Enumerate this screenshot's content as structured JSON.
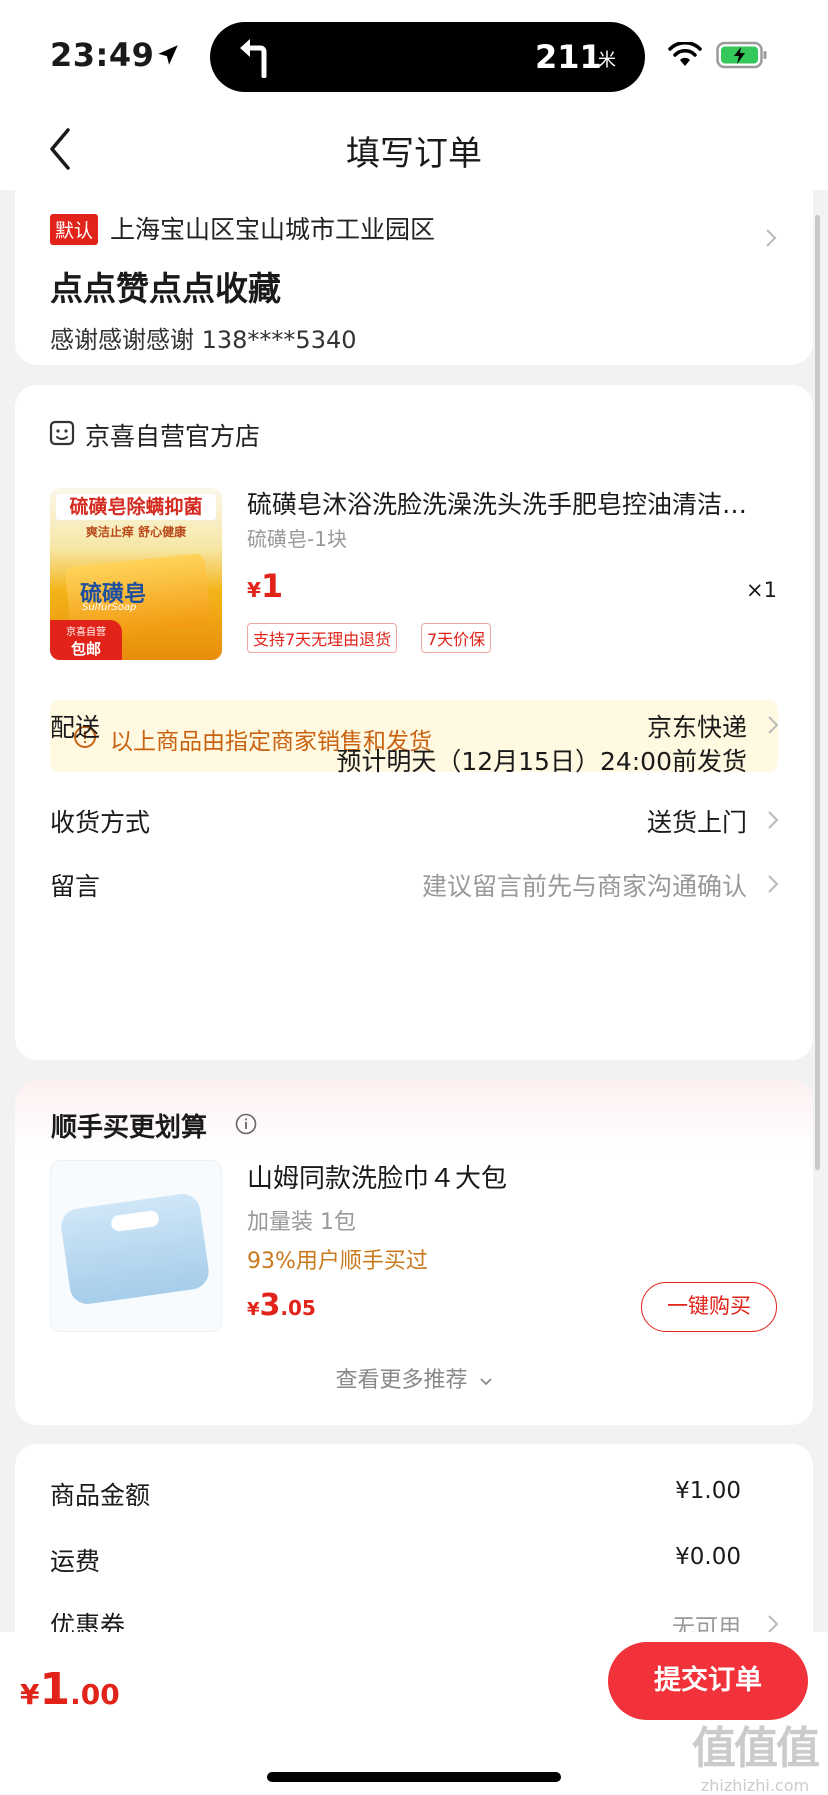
{
  "status_bar": {
    "time": "23:49",
    "nav_distance": "211",
    "nav_unit": "米"
  },
  "header": {
    "title": "填写订单"
  },
  "address": {
    "default_tag": "默认",
    "region": "上海宝山区宝山城市工业园区",
    "detail": "点点赞点点收藏",
    "contact": "感谢感谢感谢  138****5340"
  },
  "store": {
    "name": "京喜自营官方店"
  },
  "product": {
    "title": "硫磺皂沐浴洗脸洗澡洗头洗手肥皂控油清洁除螨",
    "spec": "硫磺皂-1块",
    "price_currency": "¥",
    "price": "1",
    "quantity": "×1",
    "service_tags": [
      "支持7天无理由退货",
      "7天价保"
    ],
    "image": {
      "banner": "硫磺皂除螨抑菌",
      "sub": "爽洁止痒 舒心健康",
      "name": "硫磺皂",
      "name_en": "SulfurSoap",
      "badge_top": "京喜自营",
      "badge_bottom": "包邮"
    }
  },
  "notice": {
    "text": "以上商品由指定商家销售和发货"
  },
  "delivery": {
    "label": "配送",
    "carrier": "京东快递",
    "estimate": "预计明天（12月15日）24:00前发货"
  },
  "receive_method": {
    "label": "收货方式",
    "value": "送货上门"
  },
  "message": {
    "label": "留言",
    "placeholder": "建议留言前先与商家沟通确认"
  },
  "recommend": {
    "title": "顺手买更划算",
    "item": {
      "name": "山姆同款洗脸巾４大包",
      "spec": "加量装 1包",
      "social_proof": "93%用户顺手买过",
      "price_currency": "¥",
      "price_int": "3",
      "price_dec": ".05",
      "buy_label": "一键购买"
    },
    "more_label": "查看更多推荐"
  },
  "totals": {
    "rows": [
      {
        "label": "商品金额",
        "value": "¥1.00"
      },
      {
        "label": "运费",
        "value": "¥0.00"
      },
      {
        "label": "优惠券",
        "value": "无可用"
      }
    ]
  },
  "bottom": {
    "total_currency": "¥",
    "total_int": "1",
    "total_dec": ".00",
    "submit_label": "提交订单",
    "watermark_big": "值值值",
    "watermark_small": "zhizhizhi.com"
  },
  "colors": {
    "accent_red": "#e2231a",
    "submit_red": "#f2323a",
    "notice_bg": "#fff9e1",
    "notice_text": "#c96312",
    "social_text": "#c9791e",
    "battery_green": "#34c759"
  },
  "icons": [
    "location-arrow-icon",
    "turn-left-icon",
    "wifi-icon",
    "battery-charging-icon",
    "back-chevron-icon",
    "chevron-right-icon",
    "store-icon",
    "info-circle-icon",
    "chevron-down-icon"
  ]
}
